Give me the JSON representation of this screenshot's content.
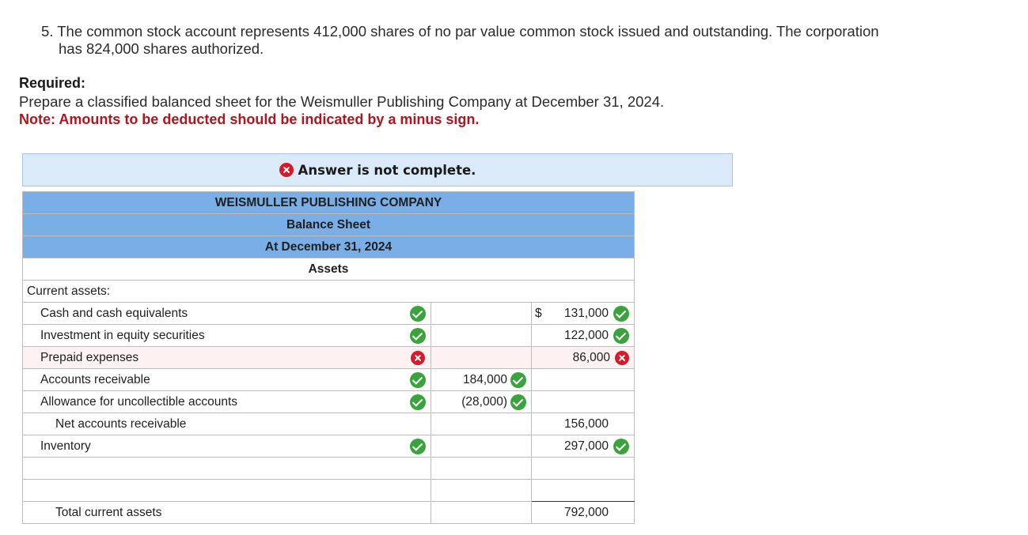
{
  "question": {
    "line1": "5. The common stock account represents 412,000 shares of no par value common stock issued and outstanding. The corporation",
    "line2": "has 824,000 shares authorized."
  },
  "required": {
    "title": "Required:",
    "text": "Prepare a classified balanced sheet for the Weismuller Publishing Company at December 31, 2024.",
    "note": "Note: Amounts to be deducted should be indicated by a minus sign."
  },
  "banner": {
    "text": "Answer is not complete.",
    "icon": "x-circle-icon"
  },
  "sheet": {
    "company": "WEISMULLER PUBLISHING COMPANY",
    "title": "Balance Sheet",
    "date": "At December 31, 2024",
    "section": "Assets",
    "group_label": "Current assets:",
    "currency_symbol": "$",
    "rows": [
      {
        "label": "Cash and cash equivalents",
        "mark": "correct",
        "mid": "",
        "amount": "131,000",
        "amount_mark": "correct"
      },
      {
        "label": "Investment in equity securities",
        "mark": "correct",
        "mid": "",
        "amount": "122,000",
        "amount_mark": "correct"
      },
      {
        "label": "Prepaid expenses",
        "mark": "incorrect",
        "mid": "",
        "amount": "86,000",
        "amount_mark": "incorrect"
      },
      {
        "label": "Accounts receivable",
        "mark": "correct",
        "mid": "184,000",
        "mid_mark": "correct",
        "amount": ""
      },
      {
        "label": "Allowance for uncollectible accounts",
        "mark": "correct",
        "mid": "(28,000)",
        "mid_mark": "correct",
        "amount": ""
      },
      {
        "label": "Net accounts receivable",
        "amount": "156,000"
      },
      {
        "label": "Inventory",
        "mark": "correct",
        "amount": "297,000",
        "amount_mark": "correct"
      }
    ],
    "total_label": "Total current assets",
    "total_amount": "792,000"
  },
  "colors": {
    "header_blue": "#7aaee6",
    "banner_bg": "#dbeaf8",
    "note_red": "#b3141d",
    "check_green": "#3ba33d",
    "x_red": "#d7192a"
  }
}
